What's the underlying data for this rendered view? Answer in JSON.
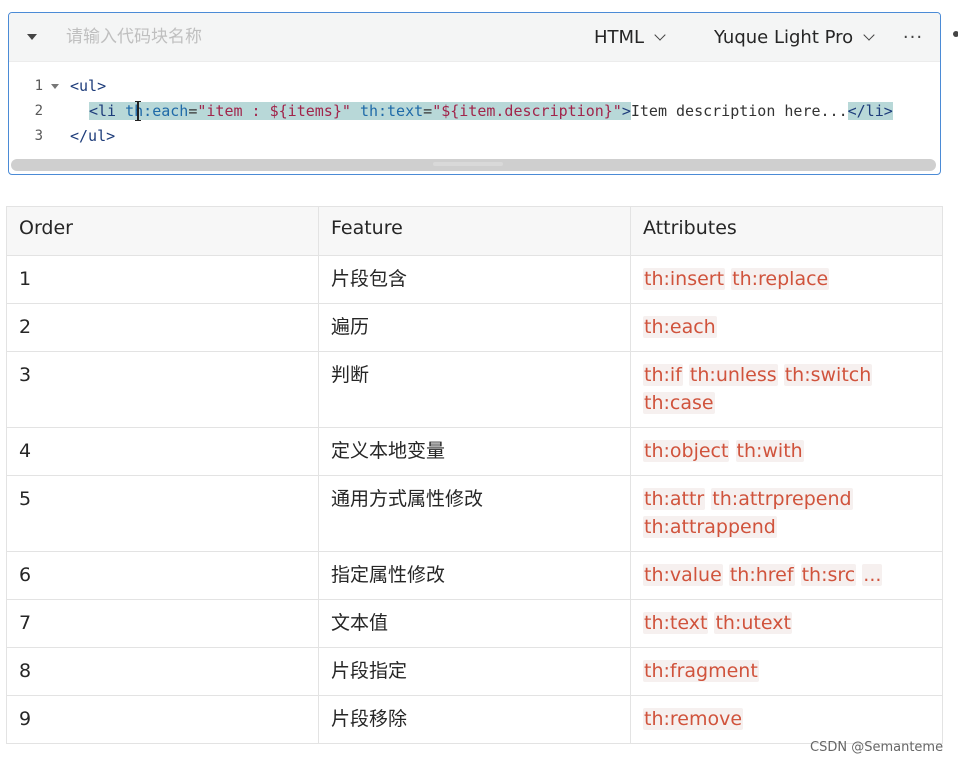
{
  "code_block": {
    "name_placeholder": "请输入代码块名称",
    "language": "HTML",
    "theme": "Yuque Light Pro",
    "more_label": "···",
    "lines": [
      {
        "number": "1"
      },
      {
        "number": "2"
      },
      {
        "number": "3"
      }
    ],
    "line1_text": "<ul>",
    "line2": {
      "open": "<li ",
      "attr1": "th:each",
      "eq1": "=",
      "val1": "\"item : ${items}\"",
      "attr2": "th:text",
      "eq2": "=",
      "val2": "\"${item.description}\"",
      "close": ">",
      "content": "Item description here...",
      "end": "</li>"
    },
    "line3_text": "</ul>"
  },
  "table": {
    "headers": [
      "Order",
      "Feature",
      "Attributes"
    ],
    "rows": [
      {
        "order": "1",
        "feature": "片段包含",
        "attrs": [
          "th:insert",
          "th:replace"
        ]
      },
      {
        "order": "2",
        "feature": "遍历",
        "attrs": [
          "th:each"
        ]
      },
      {
        "order": "3",
        "feature": "判断",
        "attrs": [
          "th:if",
          "th:unless",
          "th:switch",
          "th:case"
        ]
      },
      {
        "order": "4",
        "feature": "定义本地变量",
        "attrs": [
          "th:object",
          "th:with"
        ]
      },
      {
        "order": "5",
        "feature": "通用方式属性修改",
        "attrs": [
          "th:attr",
          "th:attrprepend",
          "th:attrappend"
        ]
      },
      {
        "order": "6",
        "feature": "指定属性修改",
        "attrs": [
          "th:value",
          "th:href",
          "th:src",
          "..."
        ]
      },
      {
        "order": "7",
        "feature": "文本值",
        "attrs": [
          "th:text",
          "th:utext"
        ]
      },
      {
        "order": "8",
        "feature": "片段指定",
        "attrs": [
          "th:fragment"
        ]
      },
      {
        "order": "9",
        "feature": "片段移除",
        "attrs": [
          "th:remove"
        ]
      }
    ]
  },
  "watermark": "CSDN @Semanteme",
  "colors": {
    "accent_border": "#4b8bd6",
    "code_tag_text": "#d0533c",
    "selection": "#b8d8d8"
  }
}
